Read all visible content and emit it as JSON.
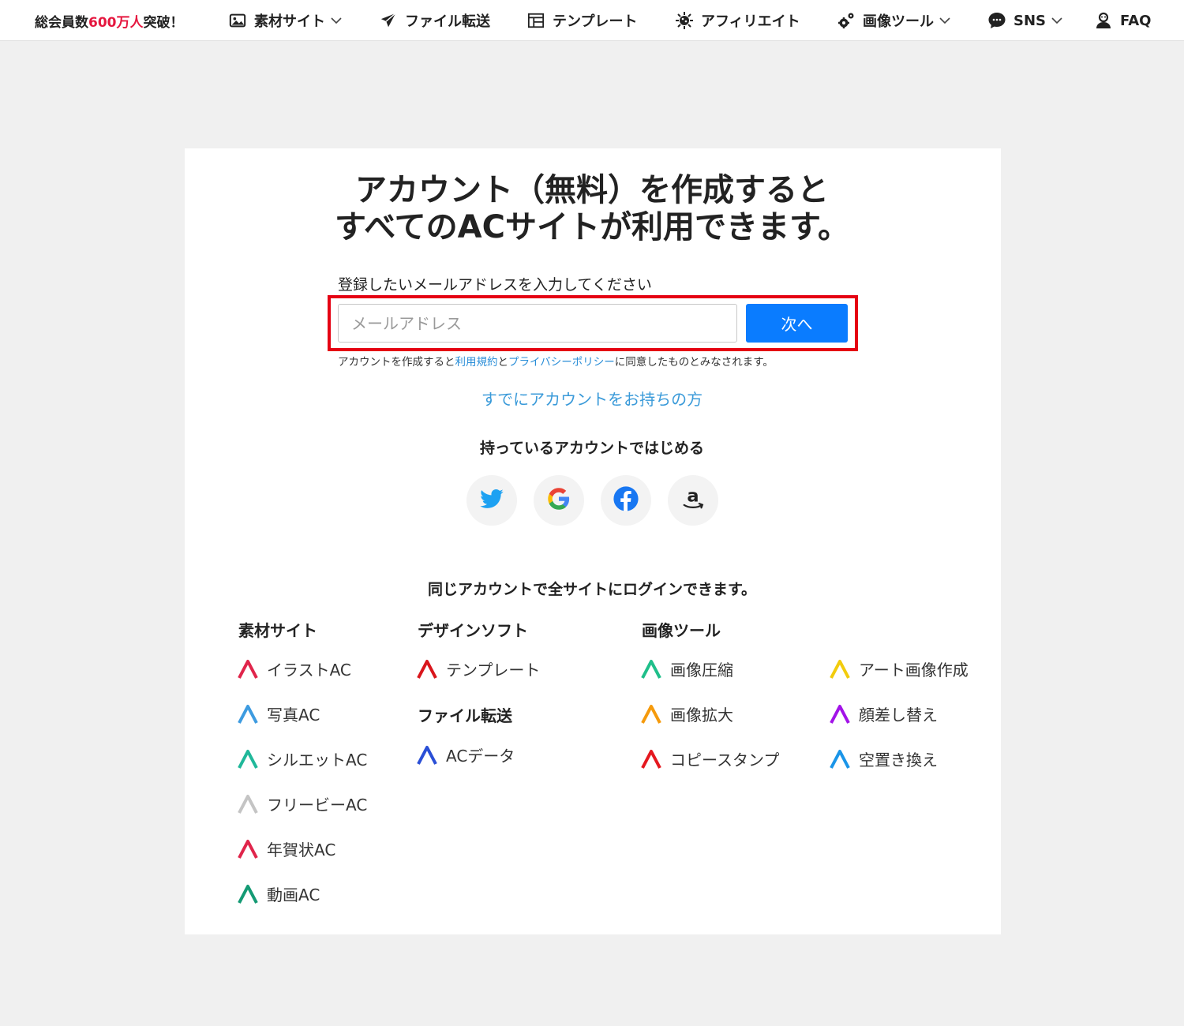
{
  "nav": {
    "promo_prefix": "総会員数",
    "promo_highlight": "600万人",
    "promo_suffix": "突破！",
    "items": [
      {
        "label": "素材サイト",
        "icon": "image-icon"
      },
      {
        "label": "ファイル転送",
        "icon": "paper-plane-icon"
      },
      {
        "label": "テンプレート",
        "icon": "template-icon"
      },
      {
        "label": "アフィリエイト",
        "icon": "virus-icon"
      },
      {
        "label": "画像ツール",
        "icon": "gears-icon"
      },
      {
        "label": "SNS",
        "icon": "chat-bubble-icon"
      },
      {
        "label": "FAQ",
        "icon": "user-support-icon"
      }
    ]
  },
  "headline": {
    "line1": "アカウント（無料）を作成すると",
    "line2": "すべてのACサイトが利用できます。"
  },
  "signup": {
    "label": "登録したいメールアドレスを入力してください",
    "email_placeholder": "メールアドレス",
    "email_value": "",
    "next_label": "次へ"
  },
  "terms": {
    "prefix": "アカウントを作成すると",
    "link1": "利用規約",
    "middle": "と",
    "link2": "プライバシーポリシー",
    "suffix": "に同意したものとみなされます。"
  },
  "existing_account_link": "すでにアカウントをお持ちの方",
  "social": {
    "title": "持っているアカウントではじめる",
    "providers": [
      "twitter-icon",
      "google-icon",
      "facebook-icon",
      "amazon-icon"
    ]
  },
  "sites": {
    "title": "同じアカウントで全サイトにログインできます。",
    "material_heading": "素材サイト",
    "material": [
      {
        "label": "イラストAC",
        "color": "#e0254b"
      },
      {
        "label": "写真AC",
        "color": "#3d9be0"
      },
      {
        "label": "シルエットAC",
        "color": "#20b89a"
      },
      {
        "label": "フリービーAC",
        "color": "#c4c4c4"
      },
      {
        "label": "年賀状AC",
        "color": "#e0254b"
      },
      {
        "label": "動画AC",
        "color": "#149a74"
      }
    ],
    "design_heading": "デザインソフト",
    "design": [
      {
        "label": "テンプレート",
        "color": "#d9161c"
      }
    ],
    "transfer_heading": "ファイル転送",
    "transfer": [
      {
        "label": "ACデータ",
        "color": "#2a4fd6"
      }
    ],
    "tools_heading": "画像ツール",
    "tools_col1": [
      {
        "label": "画像圧縮",
        "color": "#1fbf8a"
      },
      {
        "label": "画像拡大",
        "color": "#f59a0c"
      },
      {
        "label": "コピースタンプ",
        "color": "#e5181f"
      }
    ],
    "tools_col2": [
      {
        "label": "アート画像作成",
        "color": "#f2cc0d"
      },
      {
        "label": "顔差し替え",
        "color": "#a213e8"
      },
      {
        "label": "空置き換え",
        "color": "#1a95e8"
      }
    ]
  }
}
